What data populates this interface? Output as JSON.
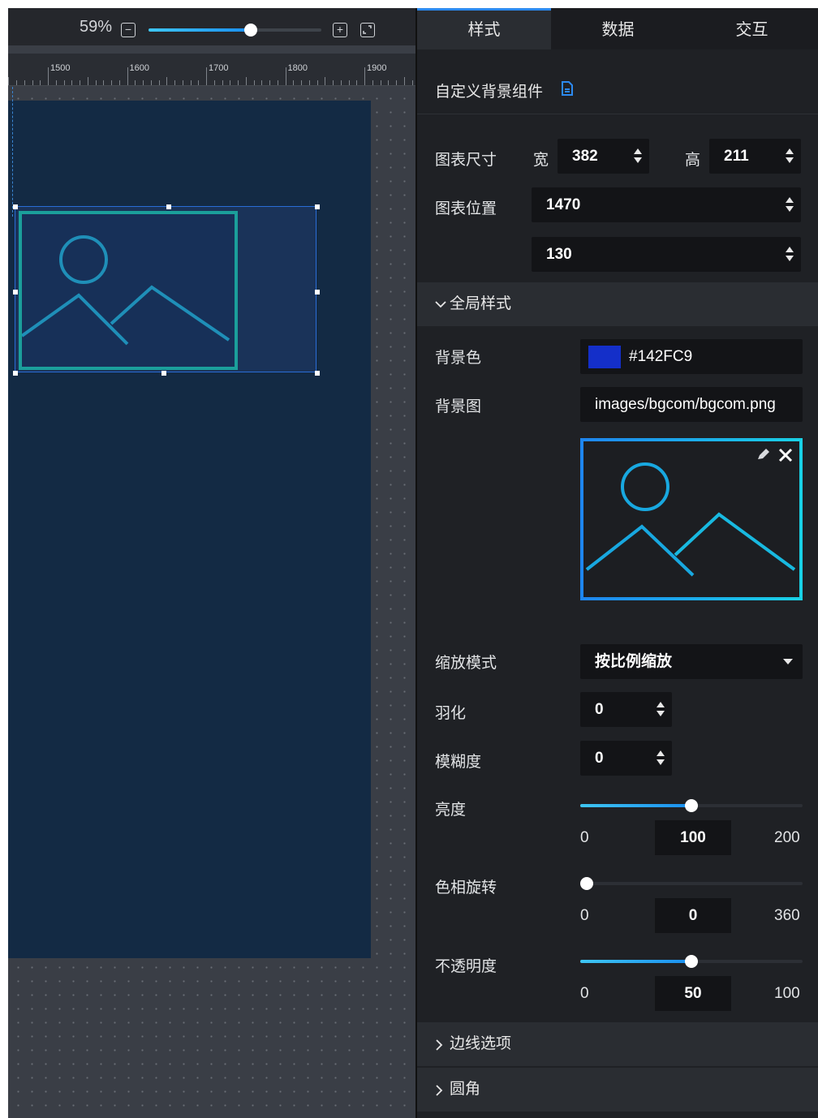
{
  "canvas": {
    "zoom": {
      "percent_label": "59%",
      "value": 0.59,
      "minus_icon": "minus-square-icon",
      "plus_icon": "plus-square-icon",
      "fit_icon": "fit-screen-icon"
    },
    "ruler": {
      "labels": [
        "1500",
        "1600",
        "1700",
        "1800",
        "1900"
      ]
    },
    "board_color": "#132a44",
    "component_icon": "image-placeholder-icon"
  },
  "panel": {
    "tabs": [
      {
        "label": "样式",
        "active": true
      },
      {
        "label": "数据",
        "active": false
      },
      {
        "label": "交互",
        "active": false
      }
    ],
    "title": "自定义背景组件",
    "title_icon": "document-icon",
    "size": {
      "label": "图表尺寸",
      "width_label": "宽",
      "width": "382",
      "height_label": "高",
      "height": "211"
    },
    "position": {
      "label": "图表位置",
      "x": "1470",
      "y": "130"
    },
    "global_section": {
      "label": "全局样式",
      "icon": "chevron-down-icon"
    },
    "bg_color": {
      "label": "背景色",
      "swatch": "#142FC9",
      "value": "#142FC9"
    },
    "bg_image": {
      "label": "背景图",
      "value": "images/bgcom/bgcom.png",
      "edit_icon": "pencil-icon",
      "close_icon": "close-icon"
    },
    "scale_mode": {
      "label": "缩放模式",
      "value": "按比例缩放"
    },
    "feather": {
      "label": "羽化",
      "value": "0"
    },
    "blur": {
      "label": "模糊度",
      "value": "0"
    },
    "brightness": {
      "label": "亮度",
      "min": "0",
      "max": "200",
      "value": "100",
      "fraction": 0.5
    },
    "hue_rotate": {
      "label": "色相旋转",
      "min": "0",
      "max": "360",
      "value": "0",
      "fraction": 0
    },
    "opacity": {
      "label": "不透明度",
      "min": "0",
      "max": "100",
      "value": "50",
      "fraction": 0.5
    },
    "border_section": {
      "label": "边线选项",
      "icon": "chevron-right-icon"
    },
    "radius_section": {
      "label": "圆角",
      "icon": "chevron-right-icon"
    }
  }
}
